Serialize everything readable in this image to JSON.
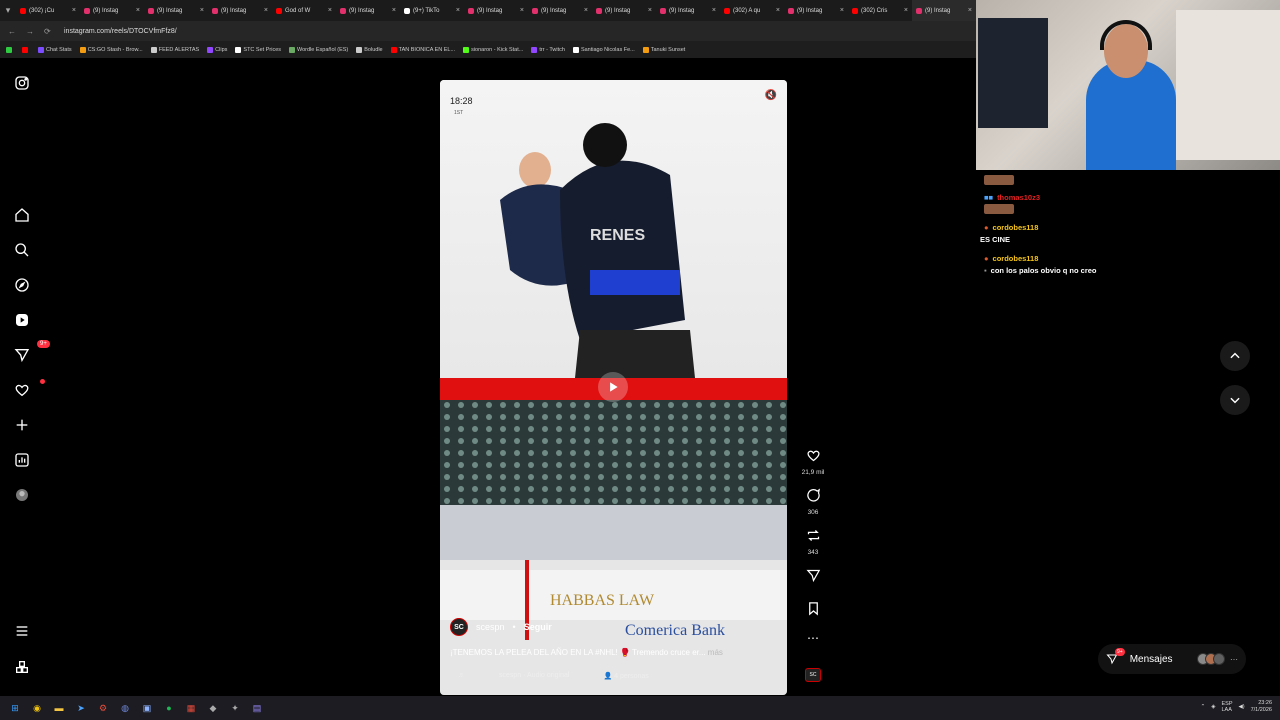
{
  "browser": {
    "tabs": [
      {
        "label": "(302) ¡Cu",
        "color": "#ff0000"
      },
      {
        "label": "(9) Instag",
        "color": "#e1306c"
      },
      {
        "label": "(9) Instag",
        "color": "#e1306c"
      },
      {
        "label": "(9) Instag",
        "color": "#e1306c"
      },
      {
        "label": "God of W",
        "color": "#ff0000"
      },
      {
        "label": "(9) Instag",
        "color": "#e1306c"
      },
      {
        "label": "(9+) TikTo",
        "color": "#ffffff"
      },
      {
        "label": "(9) Instag",
        "color": "#e1306c"
      },
      {
        "label": "(9) Instag",
        "color": "#e1306c"
      },
      {
        "label": "(9) Instag",
        "color": "#e1306c"
      },
      {
        "label": "(9) Instag",
        "color": "#e1306c"
      },
      {
        "label": "(302) A qu",
        "color": "#ff0000"
      },
      {
        "label": "(9) Instag",
        "color": "#e1306c"
      },
      {
        "label": "(302) Cris",
        "color": "#ff0000"
      },
      {
        "label": "(9) Instag",
        "color": "#e1306c",
        "active": true
      }
    ],
    "url": "instagram.com/reels/DTOCVfmFfz8/",
    "bookmarks": [
      {
        "label": "",
        "color": "#2ecc40"
      },
      {
        "label": "",
        "color": "#ff0000"
      },
      {
        "label": "Chat Stats",
        "color": "#7b4dff"
      },
      {
        "label": "CS:GO Stash - Brow...",
        "color": "#f39c12"
      },
      {
        "label": "FEED ALERTAS",
        "color": "#cccccc"
      },
      {
        "label": "Clips",
        "color": "#9146ff"
      },
      {
        "label": "STC Set Prices",
        "color": "#ffffff"
      },
      {
        "label": "Wordle Español (ES)",
        "color": "#6aaa64"
      },
      {
        "label": "Boludle",
        "color": "#cccccc"
      },
      {
        "label": "TAN BIONICA EN EL...",
        "color": "#ff0000"
      },
      {
        "label": "sionaron - Kick Stat...",
        "color": "#53fc18"
      },
      {
        "label": "trr - Twitch",
        "color": "#9146ff"
      },
      {
        "label": "Santiago Nicolas Fe...",
        "color": "#ffffff"
      },
      {
        "label": "Tanuki Sunset",
        "color": "#f39c12"
      }
    ]
  },
  "sidebar": {
    "items": [
      {
        "name": "home-icon"
      },
      {
        "name": "search-icon"
      },
      {
        "name": "explore-icon"
      },
      {
        "name": "reels-icon"
      },
      {
        "name": "messages-icon",
        "badge": "9+"
      },
      {
        "name": "notifications-icon"
      },
      {
        "name": "create-icon"
      },
      {
        "name": "dashboard-icon"
      },
      {
        "name": "profile-avatar"
      }
    ]
  },
  "reel": {
    "score": "18:28",
    "period": "1ST",
    "author": "scespn",
    "follow_label": "Seguir",
    "caption_text": "¡TENEMOS LA PELEA DEL AÑO EN LA #NHL! 🥊 Tremendo cruce er...",
    "caption_more": "más",
    "audio": "scespn · Audio original",
    "people": "4 personas",
    "logo_text": "SC"
  },
  "actions": {
    "likes": "21,9 mil",
    "comments": "306",
    "reposts": "343"
  },
  "messages_button": {
    "label": "Mensajes",
    "badge": "9+"
  },
  "chat": [
    {
      "user": "",
      "message": "",
      "emote": true
    },
    {
      "user": "thomas10z3",
      "message": "",
      "red": true,
      "emote": true
    },
    {
      "user": "cordobes118",
      "message": "ES CINE"
    },
    {
      "user": "cordobes118",
      "message": "con los palos obvio q no creo"
    }
  ],
  "taskbar": {
    "lang": "ESP\nLAA",
    "time": "23:26",
    "date": "7/1/2026"
  }
}
